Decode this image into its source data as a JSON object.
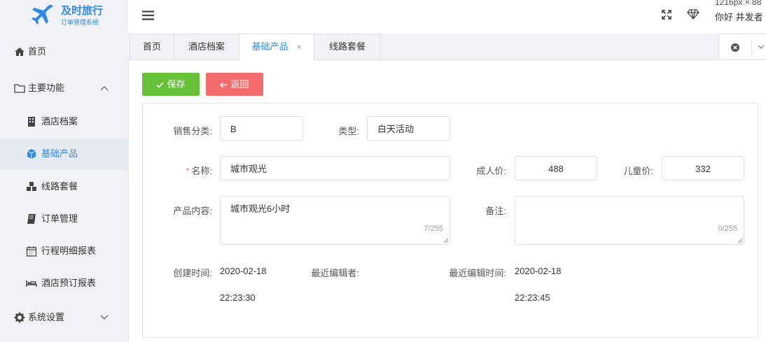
{
  "app": {
    "title": "及时旅行",
    "subtitle": "订单管理系统"
  },
  "sidebar": {
    "items": [
      {
        "label": "首页"
      },
      {
        "label": "主要功能"
      },
      {
        "label": "酒店档案"
      },
      {
        "label": "基础产品"
      },
      {
        "label": "线路套餐"
      },
      {
        "label": "订单管理"
      },
      {
        "label": "行程明细报表"
      },
      {
        "label": "酒店预订报表"
      },
      {
        "label": "系统设置"
      }
    ]
  },
  "header": {
    "size_hint": "1216px × 88",
    "user": "你好 井发者"
  },
  "tabs": [
    {
      "label": "首页"
    },
    {
      "label": "酒店档案"
    },
    {
      "label": "基础产品",
      "close": "×"
    },
    {
      "label": "线路套餐"
    }
  ],
  "toolbar": {
    "save_label": "保存",
    "back_label": "返回",
    "save_color": "#67c23a",
    "back_color": "#f56c6c"
  },
  "form": {
    "sales_category_label": "销售分类:",
    "sales_category_value": "B",
    "type_label": "类型:",
    "type_value": "白天活动",
    "required_mark": "*",
    "name_label": "名称:",
    "name_value": "城市观光",
    "adult_price_label": "成人价:",
    "adult_price_value": "488",
    "child_price_label": "儿童价:",
    "child_price_value": "332",
    "content_label": "产品内容:",
    "content_value": "城市观光6小时",
    "content_count": "7/255",
    "remark_label": "备注:",
    "remark_value": "",
    "remark_count": "0/255",
    "created_label": "创建时间:",
    "created_date": "2020-02-18",
    "created_time": "22:23:30",
    "last_editor_label": "最近编辑者:",
    "last_editor_value": "",
    "last_edit_time_label": "最近编辑时间:",
    "last_edit_date": "2020-02-18",
    "last_edit_time": "22:23:45"
  },
  "colors": {
    "accent": "#2e8ae6"
  }
}
